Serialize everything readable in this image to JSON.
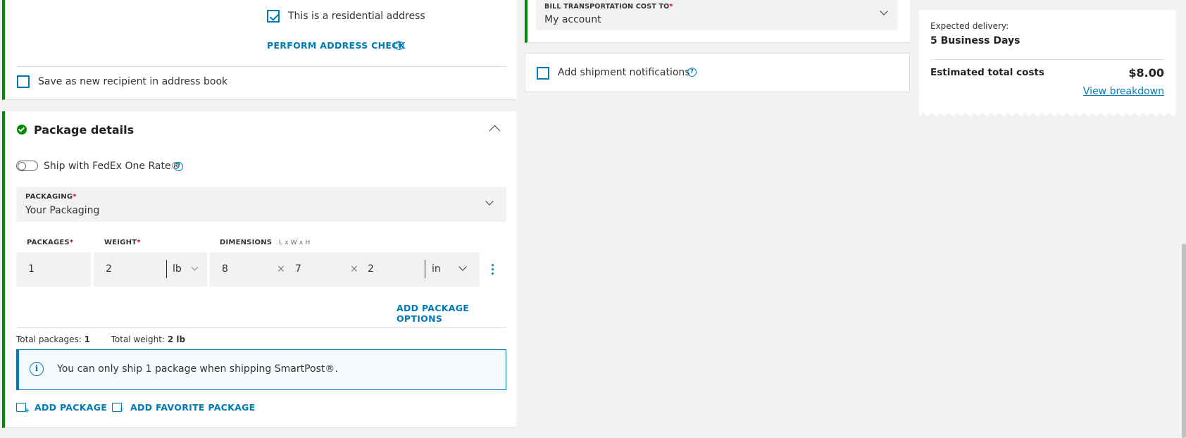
{
  "recipient": {
    "residential_label": "This is a residential address",
    "address_check_label": "PERFORM ADDRESS CHECK",
    "save_recipient_label": "Save as new recipient in address book"
  },
  "billing": {
    "label": "BILL TRANSPORTATION COST TO",
    "value": "My account"
  },
  "notifications": {
    "label": "Add shipment notifications"
  },
  "summary": {
    "expected_label": "Expected delivery:",
    "expected_value": "5 Business Days",
    "total_label": "Estimated total costs",
    "total_value": "$8.00",
    "breakdown_link": "View breakdown"
  },
  "package": {
    "title": "Package details",
    "one_rate_label": "Ship with FedEx One Rate®",
    "packaging_label": "PACKAGING",
    "packaging_value": "Your Packaging",
    "packages_label": "PACKAGES",
    "weight_label": "WEIGHT",
    "dimensions_label": "DIMENSIONS",
    "dimensions_hint": "L x W x H",
    "packages_value": "1",
    "weight_value": "2",
    "weight_unit": "lb",
    "dim_l": "8",
    "dim_w": "7",
    "dim_h": "2",
    "dim_unit": "in",
    "times": "×",
    "add_options_label": "ADD PACKAGE OPTIONS",
    "total_packages_label": "Total packages:",
    "total_packages_value": "1",
    "total_weight_label": "Total weight:",
    "total_weight_value": "2 lb",
    "info_text": "You can only ship 1 package when shipping SmartPost®.",
    "add_package_label": "ADD PACKAGE",
    "add_favorite_label": "ADD FAVORITE PACKAGE"
  },
  "colors": {
    "accent_blue": "#007ab7",
    "success_green": "#008a00",
    "required_red": "#de002e"
  }
}
